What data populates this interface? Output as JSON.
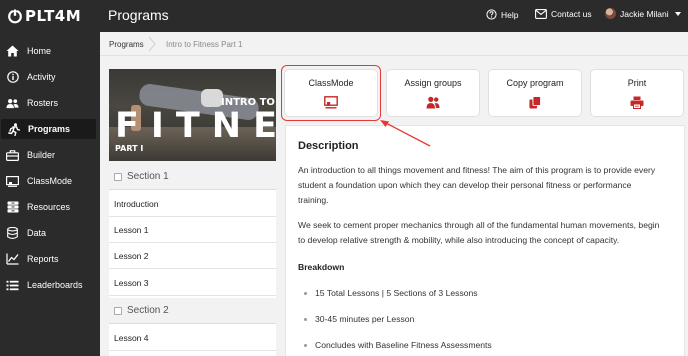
{
  "app": {
    "logo_text": "PLT4M",
    "title": "Programs"
  },
  "topbar": {
    "help_label": "Help",
    "contact_label": "Contact us",
    "user_name": "Jackie Milani"
  },
  "sidebar": {
    "items": [
      {
        "label": "Home",
        "icon": "home-icon"
      },
      {
        "label": "Activity",
        "icon": "info-icon"
      },
      {
        "label": "Rosters",
        "icon": "users-icon"
      },
      {
        "label": "Programs",
        "icon": "runner-icon",
        "active": true
      },
      {
        "label": "Builder",
        "icon": "toolbox-icon"
      },
      {
        "label": "ClassMode",
        "icon": "chalkboard-icon"
      },
      {
        "label": "Resources",
        "icon": "archive-icon"
      },
      {
        "label": "Data",
        "icon": "database-icon"
      },
      {
        "label": "Reports",
        "icon": "chart-icon"
      },
      {
        "label": "Leaderboards",
        "icon": "list-icon"
      }
    ]
  },
  "breadcrumb": {
    "root": "Programs",
    "current": "Intro to Fitness Part 1"
  },
  "hero": {
    "intro_text": "INTRO TO",
    "big_text": "FITNESS",
    "part_text": "PART I"
  },
  "lesson_list": {
    "section_1": "Section 1",
    "section_2": "Section 2",
    "items": [
      "Introduction",
      "Lesson 1",
      "Lesson 2",
      "Lesson 3",
      "Lesson 4"
    ]
  },
  "actions": {
    "classmode": "ClassMode",
    "assign_groups": "Assign groups",
    "copy_program": "Copy program",
    "print": "Print"
  },
  "description": {
    "title": "Description",
    "p1_line1": "An introduction to all things movement and fitness! The aim of this program is to provide every",
    "p1_line2": "student a foundation upon which they can develop their personal fitness or performance",
    "p1_line3": "training.",
    "p2_line1": "We seek to cement proper mechanics through all of the fundamental human movements, begin",
    "p2_line2": "to develop relative strength & mobility, while also introducing the concept of capacity.",
    "breakdown_title": "Breakdown",
    "bullets": [
      "15 Total Lessons | 5 Sections of 3 Lessons",
      "30-45 minutes per Lesson",
      "Concludes with Baseline Fitness Assessments"
    ]
  },
  "colors": {
    "accent": "#c62828",
    "highlight": "#e53935",
    "sidebar_bg": "#2b2b2b"
  }
}
